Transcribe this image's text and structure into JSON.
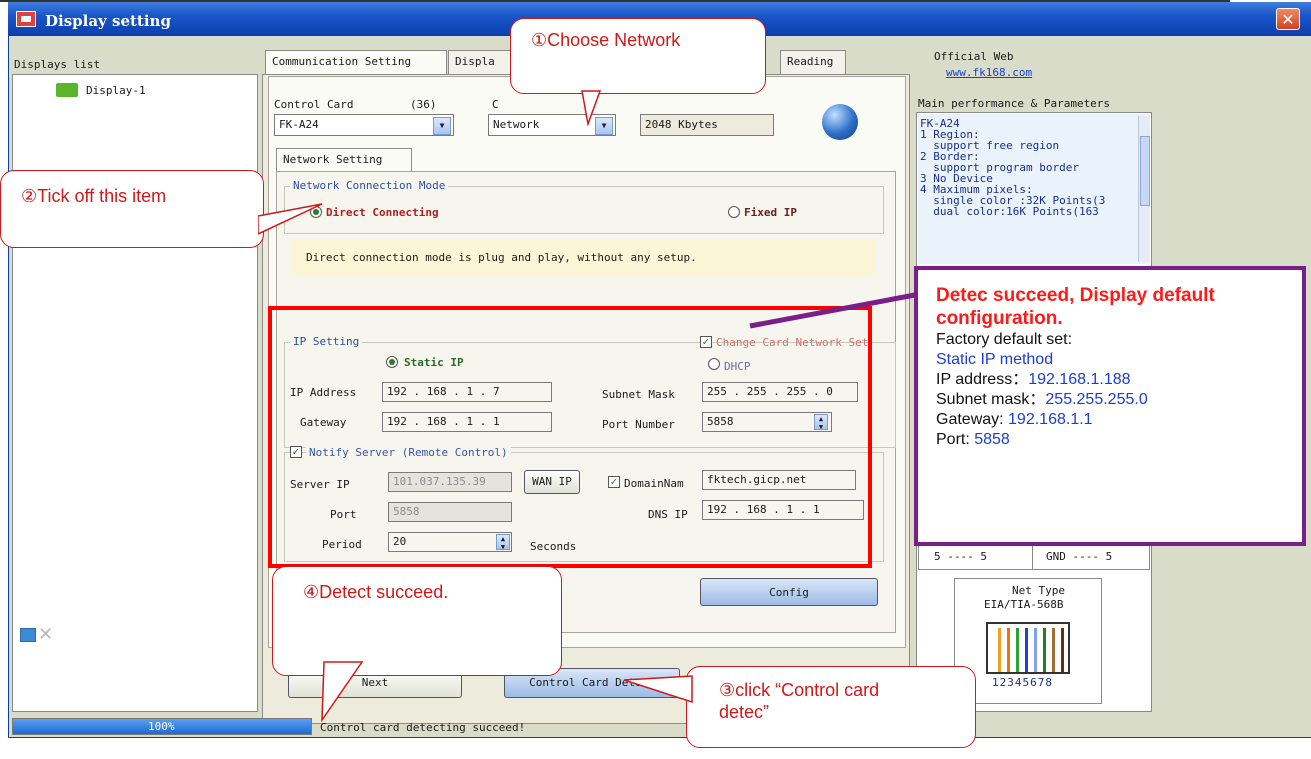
{
  "window": {
    "title": "Display setting"
  },
  "displays": {
    "header": "Displays list",
    "items": [
      "Display-1"
    ]
  },
  "tabs": [
    "Communication Setting",
    "Displa",
    "Reading"
  ],
  "control_card": {
    "label": "Control Card",
    "count": "(36)",
    "value": "FK-A24",
    "comm_label": "C",
    "comm_value": "Network",
    "memory": "2048 Kbytes"
  },
  "network_tab": "Network Setting",
  "connection_mode": {
    "title": "Network Connection Mode",
    "direct": "Direct Connecting",
    "fixed": "Fixed IP",
    "hint": "Direct connection mode is plug and play, without any setup."
  },
  "ip_setting": {
    "title": "IP Setting",
    "change_card_network": "Change Card Network Set",
    "static_ip": "Static IP",
    "dhcp": "DHCP",
    "ip_address_label": "IP Address",
    "ip_address": "192 . 168 . 1 . 7",
    "gateway_label": "Gateway",
    "gateway": "192 . 168 . 1 . 1",
    "subnet_label": "Subnet Mask",
    "subnet": "255 . 255 . 255 . 0",
    "port_label": "Port Number",
    "port": "5858",
    "notify_server": "Notify Server (Remote Control)",
    "server_ip_label": "Server IP",
    "server_ip": "101.037.135.39",
    "wan_ip": "WAN IP",
    "domain_label": "DomainNam",
    "domain": "fktech.gicp.net",
    "port2_label": "Port",
    "port2": "5858",
    "dns_label": "DNS IP",
    "dns": "192 . 168 . 1 . 1",
    "period_label": "Period",
    "period": "20",
    "seconds": "Seconds"
  },
  "buttons": {
    "config": "Config",
    "next": "Next",
    "detect": "Control Card Detect"
  },
  "status": {
    "progress_text": "100%",
    "progress_fraction": 1.0,
    "message": "Control card detecting succeed!"
  },
  "right": {
    "official_web_label": "Official Web",
    "official_web_url": "www.fk168.com",
    "params_title": "Main performance & Parameters",
    "params_lines": [
      "FK-A24",
      "1 Region:",
      "  support free region",
      "2 Border:",
      "  support program border",
      "3 No Device",
      "4 Maximum pixels:",
      "  single color :32K Points(3",
      "  dual color:16K Points(163"
    ],
    "pin_a": "5 ---- 5",
    "pin_b": "GND ---- 5",
    "net_type_label": "Net Type",
    "net_type_value": "EIA/TIA-568B",
    "pins": "12345678"
  },
  "annotations": {
    "c1": "①Choose Network",
    "c2": "②Tick off this item",
    "c3": "③click “Control card detec”",
    "c4": "④Detect succeed.",
    "note_title": "Detec succeed, Display default configuration.",
    "note_l1": "Factory default set:",
    "note_l2": "Static IP method",
    "note_l3a": "IP address：",
    "note_l3b": "192.168.1.188",
    "note_l4a": "Subnet mask：",
    "note_l4b": "255.255.255.0",
    "note_l5a": "Gateway: ",
    "note_l5b": "192.168.1.1",
    "note_l6a": "Port: ",
    "note_l6b": "5858"
  }
}
